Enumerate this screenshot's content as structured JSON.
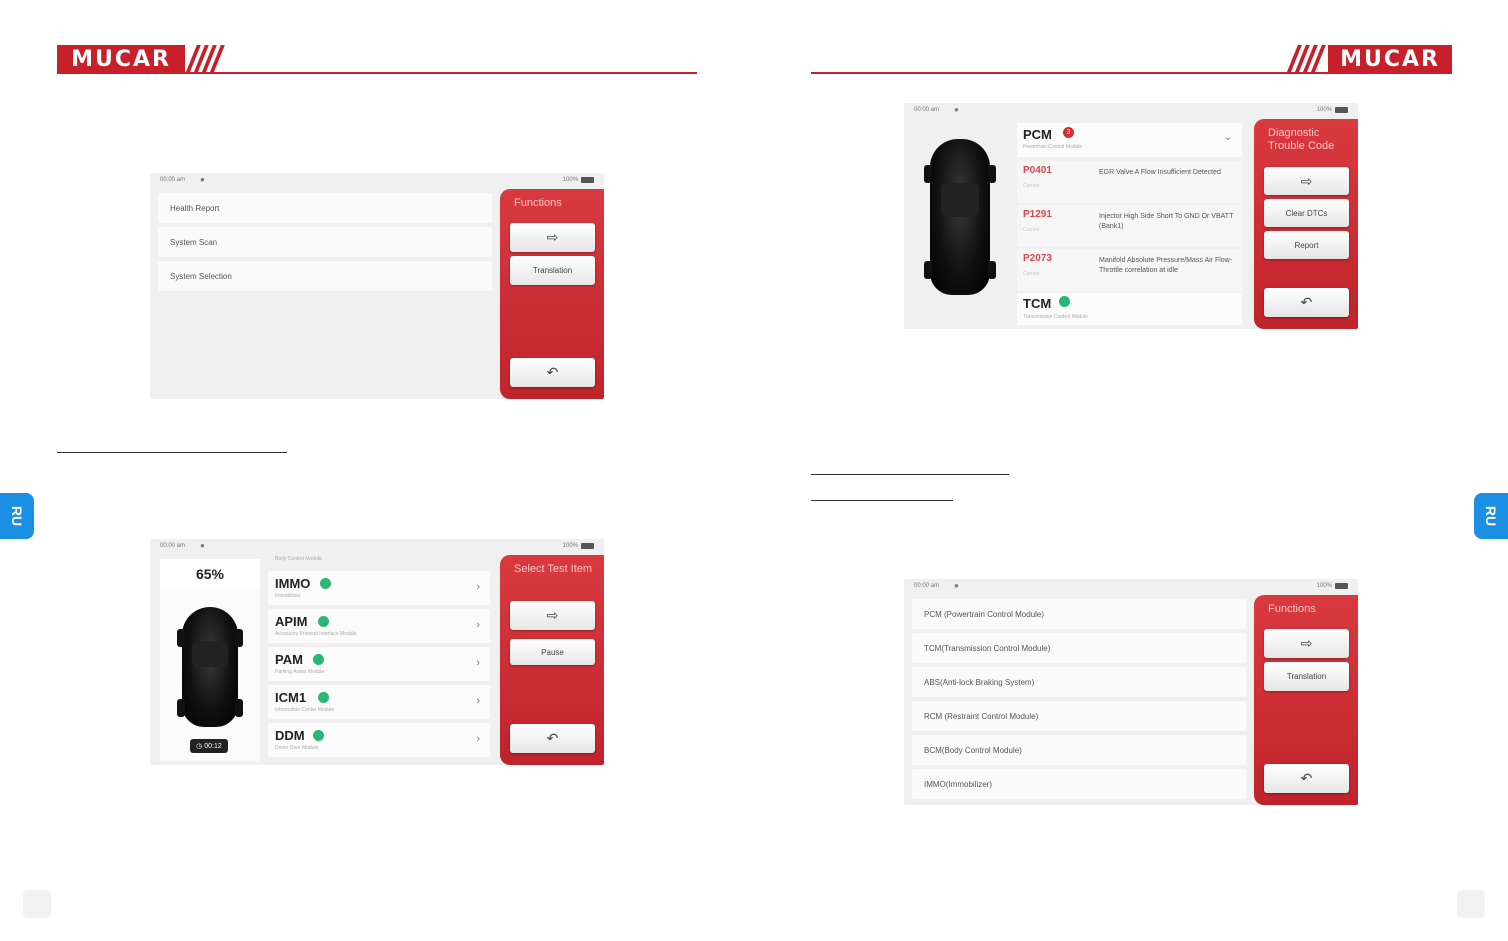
{
  "brand": {
    "logo_text": "MUCAR"
  },
  "side_tab": "RU",
  "screen_a": {
    "status": {
      "time": "00:00 am",
      "battery": "100%"
    },
    "list": [
      "Health Report",
      "System Scan",
      "System Selection"
    ],
    "panel": {
      "title": "Functions",
      "translation": "Translation"
    }
  },
  "screen_b": {
    "status": {
      "time": "00:00 am",
      "battery": "100%"
    },
    "progress": "65%",
    "timer": "00:12",
    "top_partial": "Body Control Module",
    "modules": [
      {
        "name": "IMMO",
        "sub": "Immobilizer"
      },
      {
        "name": "APIM",
        "sub": "Accessory Protocol Interface Module"
      },
      {
        "name": "PAM",
        "sub": "Parking Assist Module"
      },
      {
        "name": "ICM1",
        "sub": "Information Center Module"
      },
      {
        "name": "DDM",
        "sub": "Driver Door Module"
      }
    ],
    "panel": {
      "title": "Select Test Item",
      "pause": "Pause"
    }
  },
  "screen_c": {
    "status": {
      "time": "00:00 am",
      "battery": "100%"
    },
    "pcm": {
      "name": "PCM",
      "sub": "Powertrain Control Module",
      "badge": "3"
    },
    "dtcs": [
      {
        "code": "P0401",
        "status": "Current",
        "desc": "EGR Valve A Flow Insufficient Detected"
      },
      {
        "code": "P1291",
        "status": "Current",
        "desc": "Injector High Side Short To GND Or VBATT (Bank1)"
      },
      {
        "code": "P2073",
        "status": "Current",
        "desc": "Manifold Absolute Pressure/Mass Air Flow-Throttle correlation at idle"
      }
    ],
    "tcm": {
      "name": "TCM",
      "sub": "Transmission Control Module"
    },
    "panel": {
      "title": "Diagnostic Trouble Code",
      "clear": "Clear DTCs",
      "report": "Report"
    }
  },
  "screen_d": {
    "status": {
      "time": "00:00 am",
      "battery": "100%"
    },
    "list": [
      "PCM (Powertrain Control Module)",
      "TCM(Transmission Control Module)",
      "ABS(Anti-lock Braking System)",
      "RCM (Restraint Control Module)",
      "BCM(Body Control Module)",
      "IMMO(Immobilizer)"
    ],
    "panel": {
      "title": "Functions",
      "translation": "Translation"
    }
  }
}
